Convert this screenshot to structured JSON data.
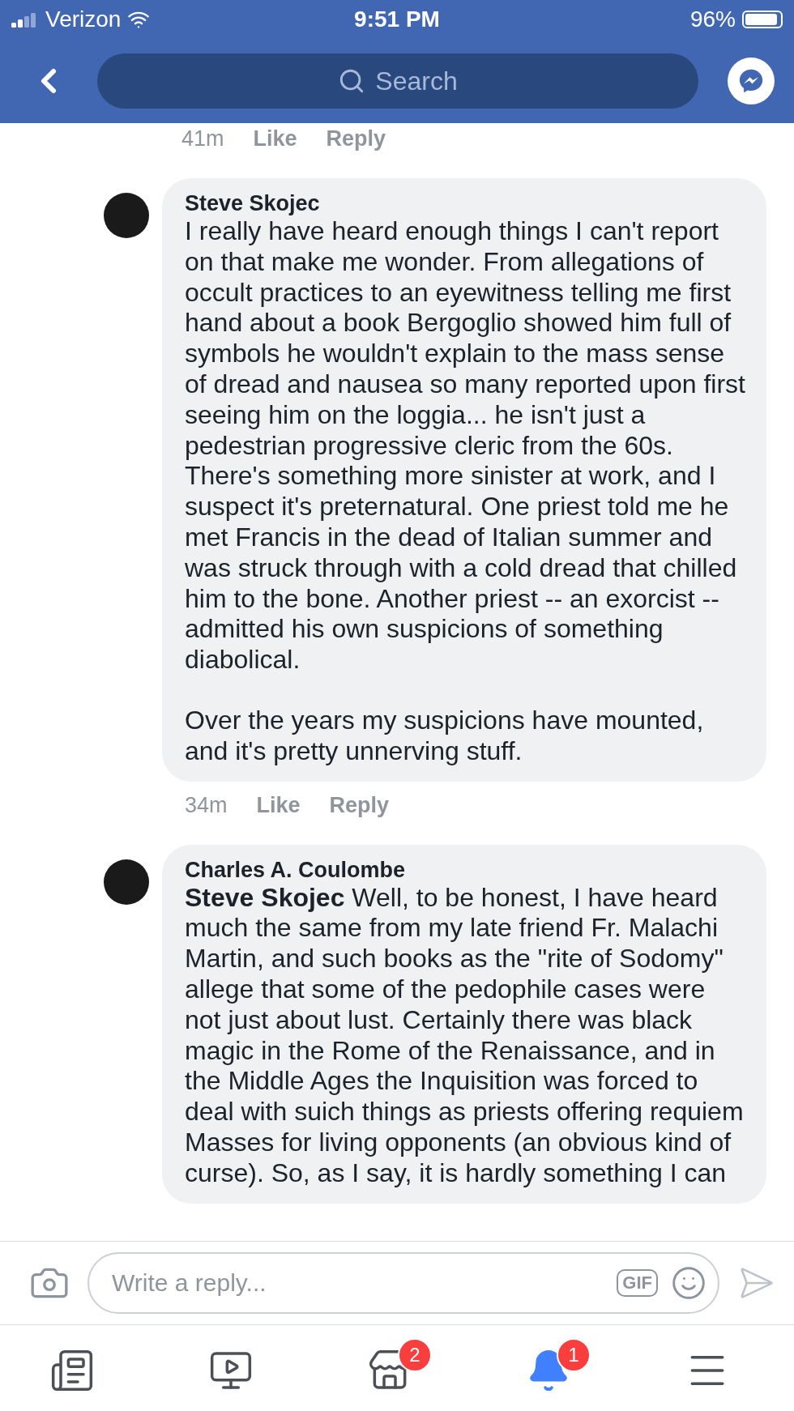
{
  "status_bar": {
    "carrier": "Verizon",
    "time": "9:51 PM",
    "battery": "96%"
  },
  "header": {
    "search": {
      "placeholder": "Search"
    }
  },
  "prev_meta": {
    "time": "41m",
    "actions": [
      "Like",
      "Reply"
    ]
  },
  "comments": [
    {
      "author": "Steve Skojec",
      "paragraphs": [
        "I really have heard enough things I can't report on that make me wonder. From allegations of occult practices to an eyewitness telling me first hand about a book Bergoglio showed him full of symbols he wouldn't explain to the mass sense of dread and nausea so many reported upon first seeing him on the loggia... he isn't just a pedestrian progressive cleric from the 60s. There's something more sinister at work, and I suspect it's preternatural. One priest told me he met Francis in the dead of Italian summer and was struck through with a cold dread that chilled him to the bone. Another priest -- an exorcist -- admitted his own suspicions of something diabolical.",
        "Over the years my suspicions have mounted, and it's pretty unnerving stuff."
      ],
      "time": "34m",
      "actions": [
        "Like",
        "Reply"
      ]
    },
    {
      "author": "Charles A. Coulombe",
      "paragraphs": [
        "**Steve Skojec** Well, to be honest, I have heard much the same from my late friend Fr. Malachi Martin, and such books as the \"rite of Sodomy\" allege that some of the pedophile cases were not just about lust. Certainly there was black magic in the Rome of the Renaissance, and in the Middle Ages the  Inquisition was forced to deal with suich things as priests offering requiem Masses for living opponents (an obvious kind of curse). So, as I say, it is hardly something I can"
      ]
    }
  ],
  "composer": {
    "placeholder": "Write a reply...",
    "gif": "GIF"
  },
  "tabs": [
    {
      "kind": "feed",
      "selected": false
    },
    {
      "kind": "video",
      "selected": false
    },
    {
      "kind": "market",
      "selected": false,
      "badge": "2"
    },
    {
      "kind": "bell",
      "selected": true,
      "badge": "1"
    },
    {
      "kind": "menu",
      "selected": false
    }
  ]
}
